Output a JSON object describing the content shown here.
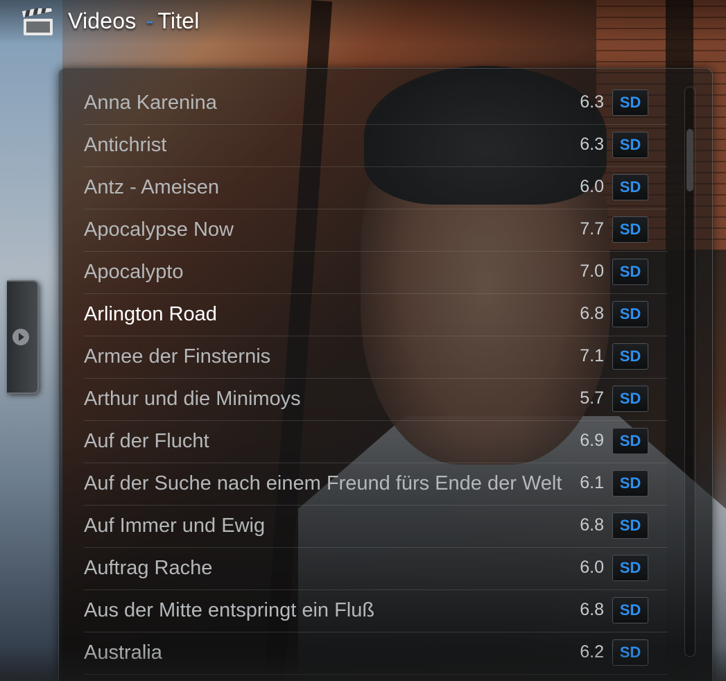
{
  "header": {
    "section": "Videos",
    "separator": "-",
    "view": "Titel"
  },
  "icons": {
    "header": "clapperboard-icon",
    "side_tab": "chevron-right-circle-icon"
  },
  "colors": {
    "accent": "#2b8ae6",
    "badge_text": "#2e8fef",
    "focused_text": "#ffffff",
    "normal_text": "#b5b8ba"
  },
  "movies": [
    {
      "title": "Anna Karenina",
      "rating": "6.3",
      "quality": "SD"
    },
    {
      "title": "Antichrist",
      "rating": "6.3",
      "quality": "SD"
    },
    {
      "title": "Antz - Ameisen",
      "rating": "6.0",
      "quality": "SD"
    },
    {
      "title": "Apocalypse Now",
      "rating": "7.7",
      "quality": "SD"
    },
    {
      "title": "Apocalypto",
      "rating": "7.0",
      "quality": "SD"
    },
    {
      "title": "Arlington Road",
      "rating": "6.8",
      "quality": "SD",
      "focused": true
    },
    {
      "title": "Armee der Finsternis",
      "rating": "7.1",
      "quality": "SD"
    },
    {
      "title": "Arthur und die Minimoys",
      "rating": "5.7",
      "quality": "SD"
    },
    {
      "title": "Auf der Flucht",
      "rating": "6.9",
      "quality": "SD"
    },
    {
      "title": "Auf der Suche nach einem Freund fürs Ende der Welt",
      "rating": "6.1",
      "quality": "SD"
    },
    {
      "title": "Auf Immer und Ewig",
      "rating": "6.8",
      "quality": "SD"
    },
    {
      "title": "Auftrag Rache",
      "rating": "6.0",
      "quality": "SD"
    },
    {
      "title": "Aus der Mitte entspringt ein Fluß",
      "rating": "6.8",
      "quality": "SD"
    },
    {
      "title": "Australia",
      "rating": "6.2",
      "quality": "SD"
    }
  ]
}
